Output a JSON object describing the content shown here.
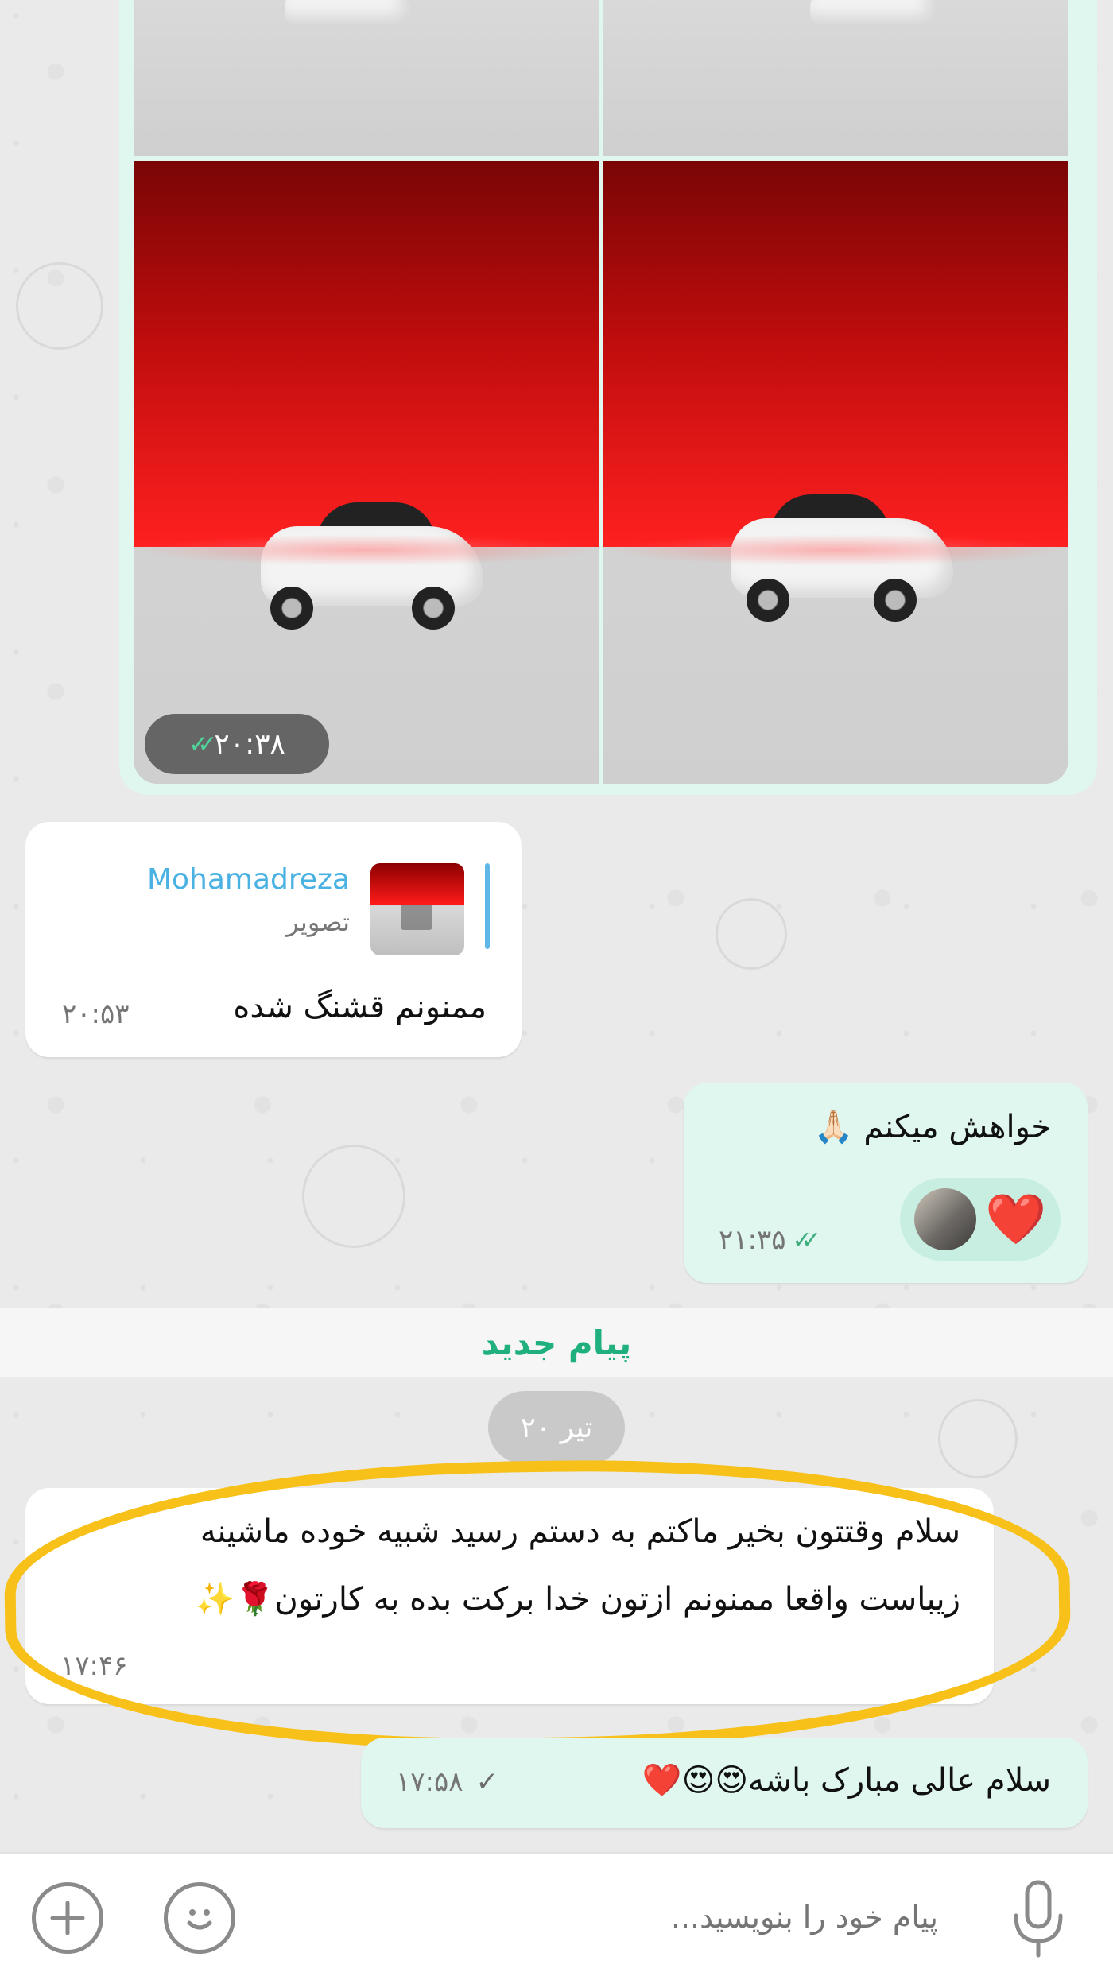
{
  "album": {
    "time": "۲۰:۳۸",
    "status_icon": "double-check-icon"
  },
  "reply_message": {
    "reply_to_name": "Mohamadreza",
    "reply_to_type": "تصویر",
    "text": "ممنونم قشنگ شده",
    "time": "۲۰:۵۳"
  },
  "out_message_1": {
    "text": "خواهش میکنم 🙏🏻",
    "reaction_emoji": "❤️",
    "time": "۲۱:۳۵",
    "status_icon": "double-check-icon"
  },
  "new_messages_label": "پیام جدید",
  "date_chip": "۲۰ تیر",
  "in_message_2": {
    "line1": "سلام وقتتون بخیر ماکتم به دستم رسید شبیه خوده ماشینه",
    "line2": "زیباست واقعا ممنونم ازتون خدا برکت بده به کارتون🌹✨",
    "time": "۱۷:۴۶"
  },
  "out_message_2": {
    "text": "سلام عالی مبارک باشه😍😍❤️",
    "time": "۱۷:۵۸",
    "status_icon": "single-check-icon"
  },
  "composer": {
    "placeholder": "پیام خود را بنویسید...",
    "attach_icon": "plus-icon",
    "emoji_icon": "smile-icon",
    "mic_icon": "microphone-icon"
  },
  "colors": {
    "outgoing_bubble": "#dff7ef",
    "incoming_bubble": "#ffffff",
    "accent_green": "#20b07e",
    "reply_name": "#4ab2e3",
    "highlight": "#f7c11a"
  }
}
